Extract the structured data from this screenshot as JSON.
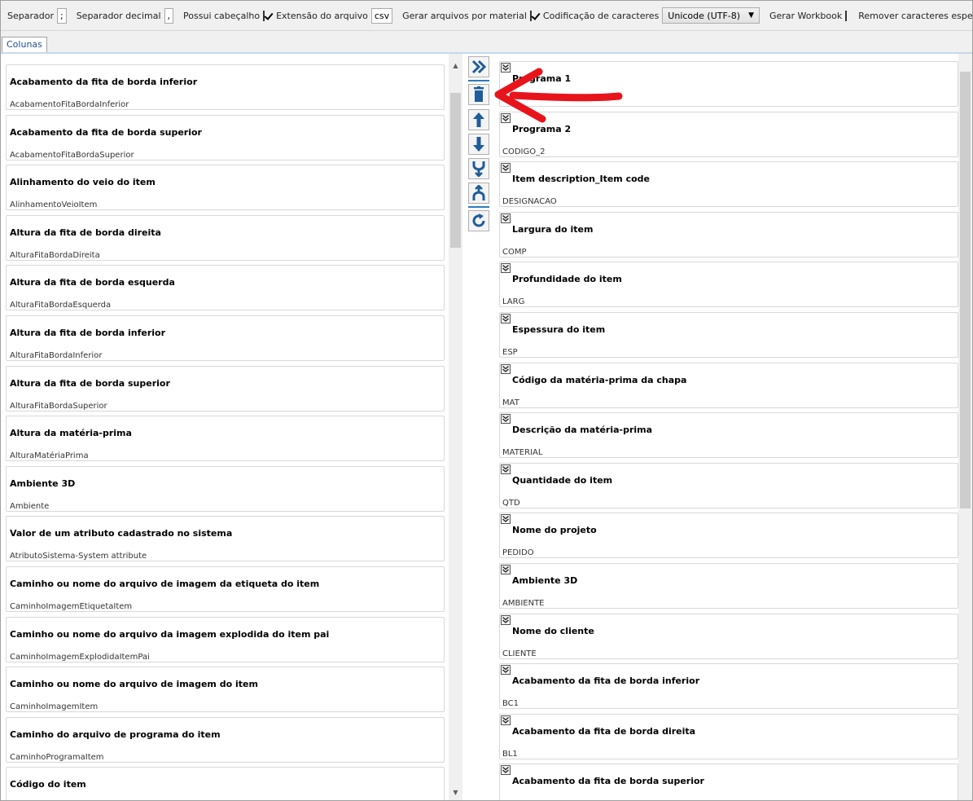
{
  "toolbar": {
    "separator_label": "Separador",
    "separator_value": ";",
    "decimal_label": "Separador decimal",
    "decimal_value": ",",
    "has_header_label": "Possui cabeçalho",
    "has_header_checked": true,
    "extension_label": "Extensão do arquivo",
    "extension_value": "csv",
    "per_material_label": "Gerar arquivos por material",
    "per_material_checked": true,
    "encoding_label": "Codificação de caracteres",
    "encoding_value": "Unicode (UTF-8)",
    "workbook_label": "Gerar Workbook",
    "workbook_checked": false,
    "remove_special_label": "Remover caracteres especiais",
    "remove_special_checked": true
  },
  "tabs": [
    {
      "label": "Colunas"
    }
  ],
  "available_columns": [
    {
      "title": "Acabamento da fita de borda inferior",
      "code": "AcabamentoFitaBordaInferior"
    },
    {
      "title": "Acabamento da fita de borda superior",
      "code": "AcabamentoFitaBordaSuperior"
    },
    {
      "title": "Alinhamento do veio do item",
      "code": "AlinhamentoVeioItem"
    },
    {
      "title": "Altura da fita de borda direita",
      "code": "AlturaFitaBordaDireita"
    },
    {
      "title": "Altura da fita de borda esquerda",
      "code": "AlturaFitaBordaEsquerda"
    },
    {
      "title": "Altura da fita de borda inferior",
      "code": "AlturaFitaBordaInferior"
    },
    {
      "title": "Altura da fita de borda superior",
      "code": "AlturaFitaBordaSuperior"
    },
    {
      "title": "Altura da matéria-prima",
      "code": "AlturaMatériaPrima"
    },
    {
      "title": "Ambiente 3D",
      "code": "Ambiente"
    },
    {
      "title": "Valor de um atributo cadastrado no sistema",
      "code": "AtributoSistema-System attribute"
    },
    {
      "title": "Caminho ou nome do arquivo de imagem da etiqueta do item",
      "code": "CaminhoImagemEtiquetaItem"
    },
    {
      "title": "Caminho ou nome do arquivo da imagem explodida do item pai",
      "code": "CaminhoImagemExplodidaItemPai"
    },
    {
      "title": "Caminho ou nome do arquivo de imagem do item",
      "code": "CaminhoImagemItem"
    },
    {
      "title": "Caminho do arquivo de programa do item",
      "code": "CaminhoProgramaItem"
    },
    {
      "title": "Código do item",
      "code": ""
    }
  ],
  "selected_columns": [
    {
      "title": "Programa 1",
      "code": ""
    },
    {
      "title": "Programa 2",
      "code": "CODIGO_2"
    },
    {
      "title": "Item description_Item code",
      "code": "DESIGNACAO"
    },
    {
      "title": "Largura do item",
      "code": "COMP"
    },
    {
      "title": "Profundidade do item",
      "code": "LARG"
    },
    {
      "title": "Espessura do item",
      "code": "ESP"
    },
    {
      "title": "Código da matéria-prima da chapa",
      "code": "MAT"
    },
    {
      "title": "Descrição da matéria-prima",
      "code": "MATERIAL"
    },
    {
      "title": "Quantidade do item",
      "code": "QTD"
    },
    {
      "title": "Nome do projeto",
      "code": "PEDIDO"
    },
    {
      "title": "Ambiente 3D",
      "code": "AMBIENTE"
    },
    {
      "title": "Nome do cliente",
      "code": "CLIENTE"
    },
    {
      "title": "Acabamento da fita de borda inferior",
      "code": "BC1"
    },
    {
      "title": "Acabamento da fita de borda direita",
      "code": "BL1"
    },
    {
      "title": "Acabamento da fita de borda superior",
      "code": ""
    }
  ],
  "middle_buttons": [
    {
      "name": "add-all",
      "icon": "double-chevron-right-icon"
    },
    {
      "name": "remove",
      "icon": "trash-icon"
    },
    {
      "name": "move-up",
      "icon": "arrow-up-icon"
    },
    {
      "name": "move-down",
      "icon": "arrow-down-icon"
    },
    {
      "name": "merge",
      "icon": "merge-icon"
    },
    {
      "name": "split",
      "icon": "split-icon"
    },
    {
      "name": "refresh",
      "icon": "refresh-icon"
    }
  ],
  "colors": {
    "accent": "#2e6fa8",
    "annotation": "#e8141c"
  }
}
